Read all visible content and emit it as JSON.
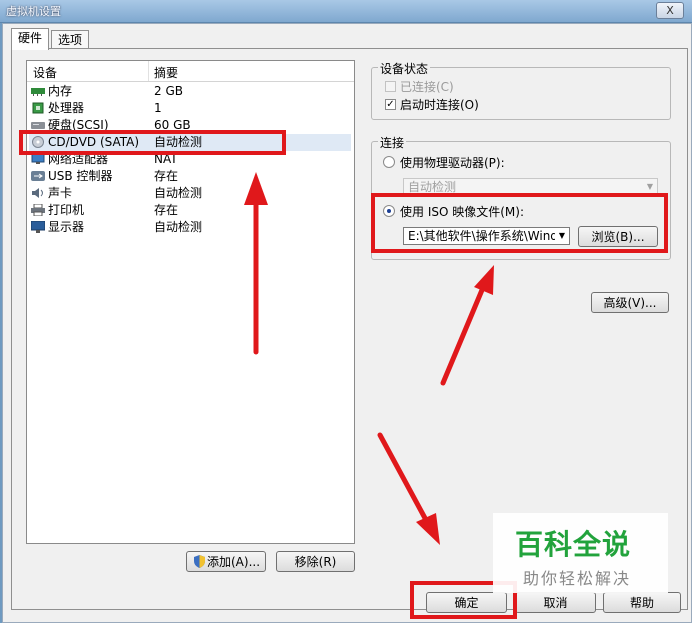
{
  "window": {
    "title": "虚拟机设置",
    "close_label": "X"
  },
  "tabs": [
    {
      "label": "硬件",
      "active": true
    },
    {
      "label": "选项",
      "active": false
    }
  ],
  "device_list": {
    "columns": [
      "设备",
      "摘要"
    ],
    "rows": [
      {
        "icon": "memory-icon",
        "name": "内存",
        "summary": "2 GB"
      },
      {
        "icon": "processor-icon",
        "name": "处理器",
        "summary": "1"
      },
      {
        "icon": "hard-disk-icon",
        "name": "硬盘(SCSI)",
        "summary": "60 GB"
      },
      {
        "icon": "cd-dvd-icon",
        "name": "CD/DVD (SATA)",
        "summary": "自动检测"
      },
      {
        "icon": "network-adapter-icon",
        "name": "网络适配器",
        "summary": "NAT"
      },
      {
        "icon": "usb-controller-icon",
        "name": "USB 控制器",
        "summary": "存在"
      },
      {
        "icon": "sound-card-icon",
        "name": "声卡",
        "summary": "自动检测"
      },
      {
        "icon": "printer-icon",
        "name": "打印机",
        "summary": "存在"
      },
      {
        "icon": "display-icon",
        "name": "显示器",
        "summary": "自动检测"
      }
    ],
    "add_button": "添加(A)...",
    "remove_button": "移除(R)"
  },
  "device_status": {
    "legend": "设备状态",
    "connected_label": "已连接(C)",
    "connected_checked": false,
    "connect_on_start_label": "启动时连接(O)",
    "connect_on_start_checked": true
  },
  "connection": {
    "legend": "连接",
    "physical_drive_label": "使用物理驱动器(P):",
    "physical_drive_value": "自动检测",
    "iso_label": "使用 ISO 映像文件(M):",
    "iso_path": "E:\\其他软件\\操作系统\\Windo",
    "browse_button": "浏览(B)..."
  },
  "advanced_button": "高级(V)...",
  "footer": {
    "ok_button": "确定",
    "cancel_button": "取消",
    "help_button": "帮助"
  },
  "watermark": {
    "main": "百科全说",
    "sub": "助你轻松解决"
  },
  "colors": {
    "annotation_red": "#e0181b",
    "watermark_green": "#22a33c"
  }
}
